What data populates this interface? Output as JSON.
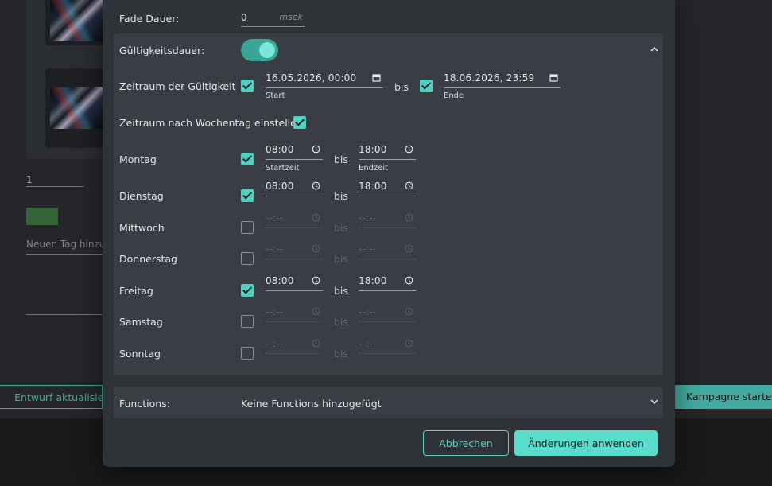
{
  "background": {
    "page_input_value": "1",
    "tag_placeholder": "Neuen Tag hinzu",
    "draft_button": "Entwurf aktualisieren",
    "start_button": "Kampagne starten"
  },
  "dialog": {
    "fade": {
      "label": "Fade Dauer:",
      "value": "0",
      "unit": "msek"
    },
    "validity": {
      "label": "Gültigkeitsdauer:",
      "enabled": true,
      "period": {
        "label": "Zeitraum der Gültigkeit",
        "start_value": "16.05.2026, 00:00",
        "start_caption": "Start",
        "separator": "bis",
        "end_value": "18.06.2026, 23:59",
        "end_caption": "Ende"
      },
      "weekday_toggle_label": "Zeitraum nach Wochentag einstellen",
      "start_caption": "Startzeit",
      "end_caption": "Endzeit",
      "days": [
        {
          "name": "Montag",
          "checked": true,
          "start": "08:00",
          "end": "18:00"
        },
        {
          "name": "Dienstag",
          "checked": true,
          "start": "08:00",
          "end": "18:00"
        },
        {
          "name": "Mittwoch",
          "checked": false,
          "start": "--:--",
          "end": "--:--"
        },
        {
          "name": "Donnerstag",
          "checked": false,
          "start": "--:--",
          "end": "--:--"
        },
        {
          "name": "Freitag",
          "checked": true,
          "start": "08:00",
          "end": "18:00"
        },
        {
          "name": "Samstag",
          "checked": false,
          "start": "--:--",
          "end": "--:--"
        },
        {
          "name": "Sonntag",
          "checked": false,
          "start": "--:--",
          "end": "--:--"
        }
      ]
    },
    "functions": {
      "label": "Functions:",
      "value": "Keine Functions hinzugefügt"
    },
    "buttons": {
      "cancel": "Abbrechen",
      "apply": "Änderungen anwenden"
    }
  },
  "colors": {
    "accent": "#4fd1c1",
    "toggle_track": "#3aa596",
    "panel": "#3a3d43",
    "dialog": "#2f3236"
  }
}
